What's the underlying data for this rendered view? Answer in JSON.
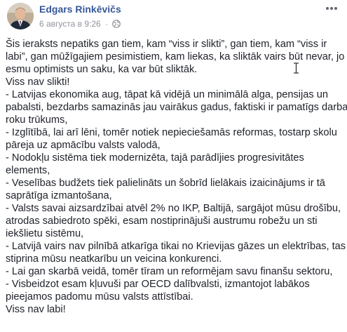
{
  "post": {
    "author": "Edgars Rinkēvičs",
    "timestamp": "6 августа в 9:26",
    "separator": "·",
    "audience_icon": "globe-icon",
    "menu_icon": "more-options-icon",
    "author_color": "#365899",
    "lines": [
      "Šis ieraksts nepatiks gan tiem, kam “viss ir slikti”, gan tiem, kam “viss ir",
      "labi”, gan mūžīgajiem pesimistiem, kam liekas, ka sliktāk vairs būt nevar, jo",
      "esmu optimists un saku, ka var būt sliktāk.",
      "Viss nav slikti!",
      "- Latvijas ekonomika aug, tāpat kā vidējā un minimālā alga, pensijas un",
      "pabalsti, bezdarbs samazinās jau vairākus gadus, faktiski ir pamatīgs darba",
      "roku trūkums,",
      "- Izglītībā, lai arī lēni, tomēr notiek nepieciešamās reformas, tostarp skolu",
      "pāreja uz apmācību valsts valodā,",
      "- Nodokļu sistēma tiek modernizēta, tajā parādījies progresivitātes",
      "elements,",
      "- Veselības budžets tiek palielināts un šobrīd lielākais izaicinājums ir tā",
      "saprātīga izmantošana,",
      "- Valsts savai aizsardzībai atvēl 2% no IKP, Baltijā, sargājot mūsu drošību,",
      "atrodas sabiedroto spēki, esam nostiprinājuši austrumu robežu un sti",
      "iekšlietu sistēmu,",
      "- Latvijā vairs nav pilnībā atkarīga tikai no Krievijas gāzes un elektrības, tas",
      "stiprina mūsu neatkarību un veicina konkurenci.",
      "- Lai gan skarbā veidā, tomēr tīram un reformējam savu finanšu sektoru,",
      "- Visbeidzot esam kļuvuši par OECD dalībvalsti, izmantojot labākos",
      "pieejamos padomu mūsu valsts attīstībai.",
      "Viss nav labi!"
    ]
  }
}
